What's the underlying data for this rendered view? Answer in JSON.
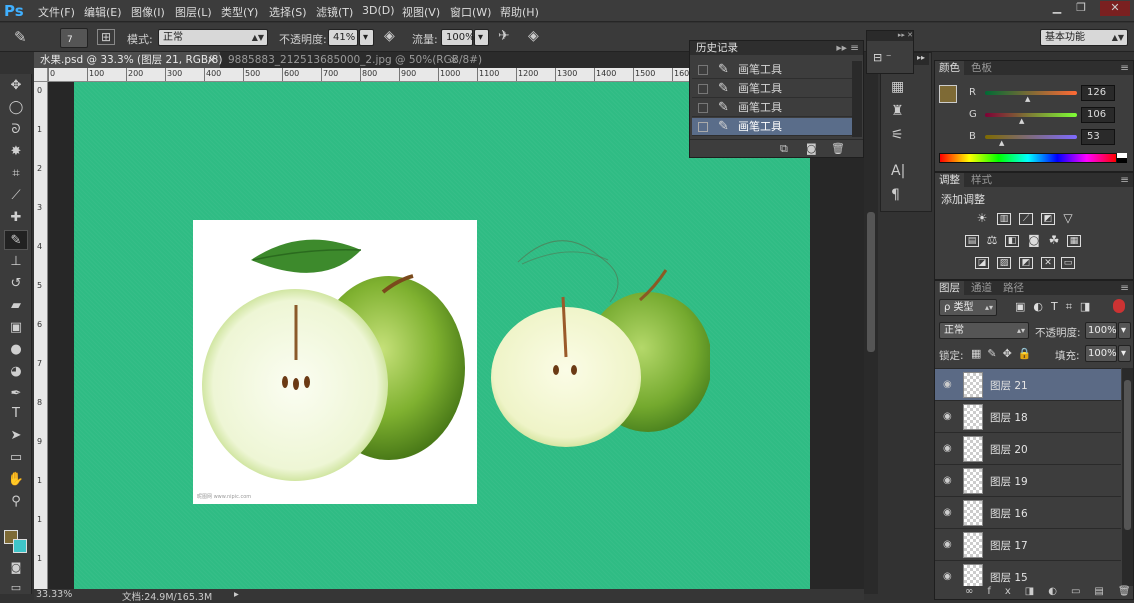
{
  "app": {
    "logo": "Ps"
  },
  "menu": [
    "文件(F)",
    "编辑(E)",
    "图像(I)",
    "图层(L)",
    "类型(Y)",
    "选择(S)",
    "滤镜(T)",
    "3D(D)",
    "视图(V)",
    "窗口(W)",
    "帮助(H)"
  ],
  "window_controls": {
    "minimize": "▁",
    "restore": "❐",
    "close": "✕"
  },
  "options": {
    "brush_size": "7",
    "mode_label": "模式:",
    "mode_value": "正常",
    "opacity_label": "不透明度:",
    "opacity_value": "41%",
    "flow_label": "流量:",
    "flow_value": "100%",
    "workspace": "基本功能"
  },
  "doc_tabs": [
    {
      "label": "水果.psd @ 33.3% (图层 21, RGB/8)",
      "close": "×"
    },
    {
      "label": "9885883_212513685000_2.jpg @ 50%(RGB/8#)",
      "close": "×"
    }
  ],
  "ruler_top": [
    "0",
    "100",
    "200",
    "300",
    "400",
    "500",
    "600",
    "700",
    "800",
    "900",
    "1000",
    "1100",
    "1200",
    "1300",
    "1400",
    "1500",
    "1600",
    "1700",
    "1800",
    "1900",
    "2000",
    "2100"
  ],
  "ruler_left": [
    "0",
    "1",
    "2",
    "3",
    "4",
    "5",
    "6",
    "7",
    "8",
    "9",
    "1",
    "1",
    "1"
  ],
  "status": {
    "zoom": "33.33%",
    "doc": "文档:24.9M/165.3M"
  },
  "history": {
    "title": "历史记录",
    "items": [
      "画笔工具",
      "画笔工具",
      "画笔工具",
      "画笔工具"
    ]
  },
  "color_panel": {
    "tabs": [
      "颜色",
      "色板"
    ],
    "r_label": "R",
    "r_value": "126",
    "g_label": "G",
    "g_value": "106",
    "b_label": "B",
    "b_value": "53",
    "fg_color": "#7e6a35",
    "bg_color": "#3fc4c8"
  },
  "adjust_panel": {
    "tabs": [
      "调整",
      "样式"
    ],
    "title": "添加调整"
  },
  "layers_panel": {
    "tabs": [
      "图层",
      "通道",
      "路径"
    ],
    "filter_label": "ρ 类型",
    "blend_mode": "正常",
    "opacity_label": "不透明度:",
    "opacity_value": "100%",
    "lock_label": "锁定:",
    "fill_label": "填充:",
    "fill_value": "100%",
    "layers": [
      "图层 21",
      "图层 18",
      "图层 20",
      "图层 19",
      "图层 16",
      "图层 17",
      "图层 15"
    ]
  },
  "canvas_color": "#2fbc84",
  "photo_watermark": "昵图网 www.nipic.com"
}
